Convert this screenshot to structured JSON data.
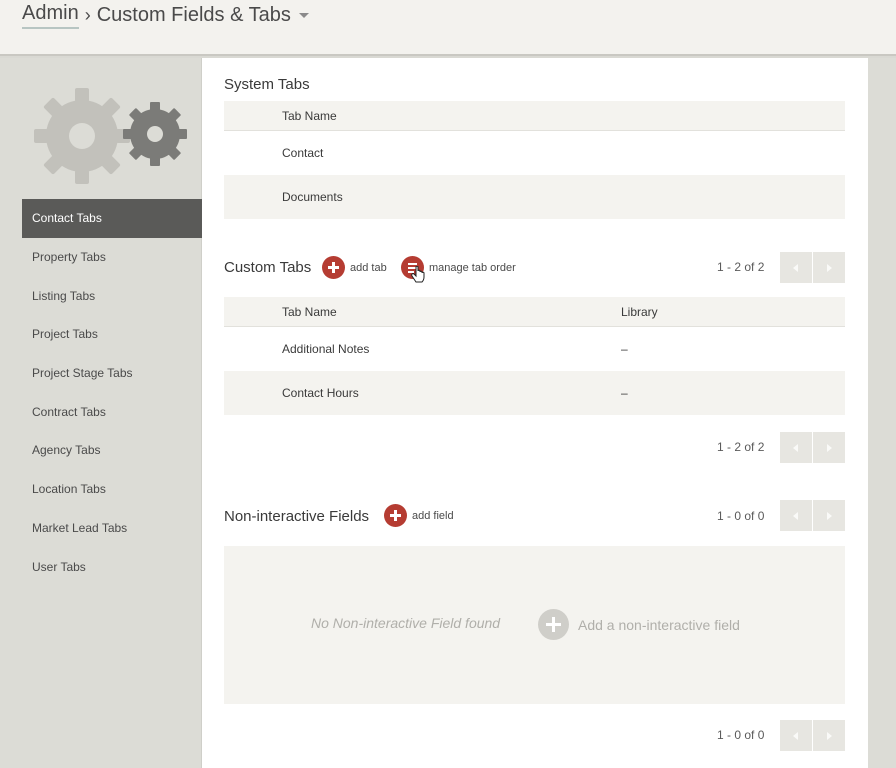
{
  "header": {
    "breadcrumb_root": "Admin",
    "breadcrumb_separator": "›",
    "breadcrumb_current": "Custom Fields & Tabs"
  },
  "sidebar": {
    "logo": "gears-icon",
    "items": [
      {
        "label": "Contact Tabs",
        "active": true
      },
      {
        "label": "Property Tabs",
        "active": false
      },
      {
        "label": "Listing Tabs",
        "active": false
      },
      {
        "label": "Project Tabs",
        "active": false
      },
      {
        "label": "Project Stage Tabs",
        "active": false
      },
      {
        "label": "Contract Tabs",
        "active": false
      },
      {
        "label": "Agency Tabs",
        "active": false
      },
      {
        "label": "Location Tabs",
        "active": false
      },
      {
        "label": "Market Lead Tabs",
        "active": false
      },
      {
        "label": "User Tabs",
        "active": false
      }
    ]
  },
  "system_tabs": {
    "title": "System Tabs",
    "column_name": "Tab Name",
    "rows": [
      {
        "name": "Contact"
      },
      {
        "name": "Documents"
      }
    ]
  },
  "custom_tabs": {
    "title": "Custom Tabs",
    "add_label": "add tab",
    "order_label": "manage tab order",
    "pager_top": "1 - 2 of 2",
    "pager_bottom": "1 - 2 of 2",
    "column_name": "Tab Name",
    "column_library": "Library",
    "rows": [
      {
        "name": "Additional Notes",
        "library": "–"
      },
      {
        "name": "Contact Hours",
        "library": "–"
      }
    ]
  },
  "non_interactive": {
    "title": "Non-interactive Fields",
    "add_label": "add field",
    "pager_top": "1 - 0 of 0",
    "pager_bottom": "1 - 0 of 0",
    "empty_text": "No Non-interactive Field found",
    "empty_add_label": "Add a non-interactive field"
  },
  "colors": {
    "accent": "#b53c32",
    "active_nav": "#5a5a58",
    "sidebar_bg": "#dcdcd6",
    "row_alt": "#f4f3ef"
  }
}
